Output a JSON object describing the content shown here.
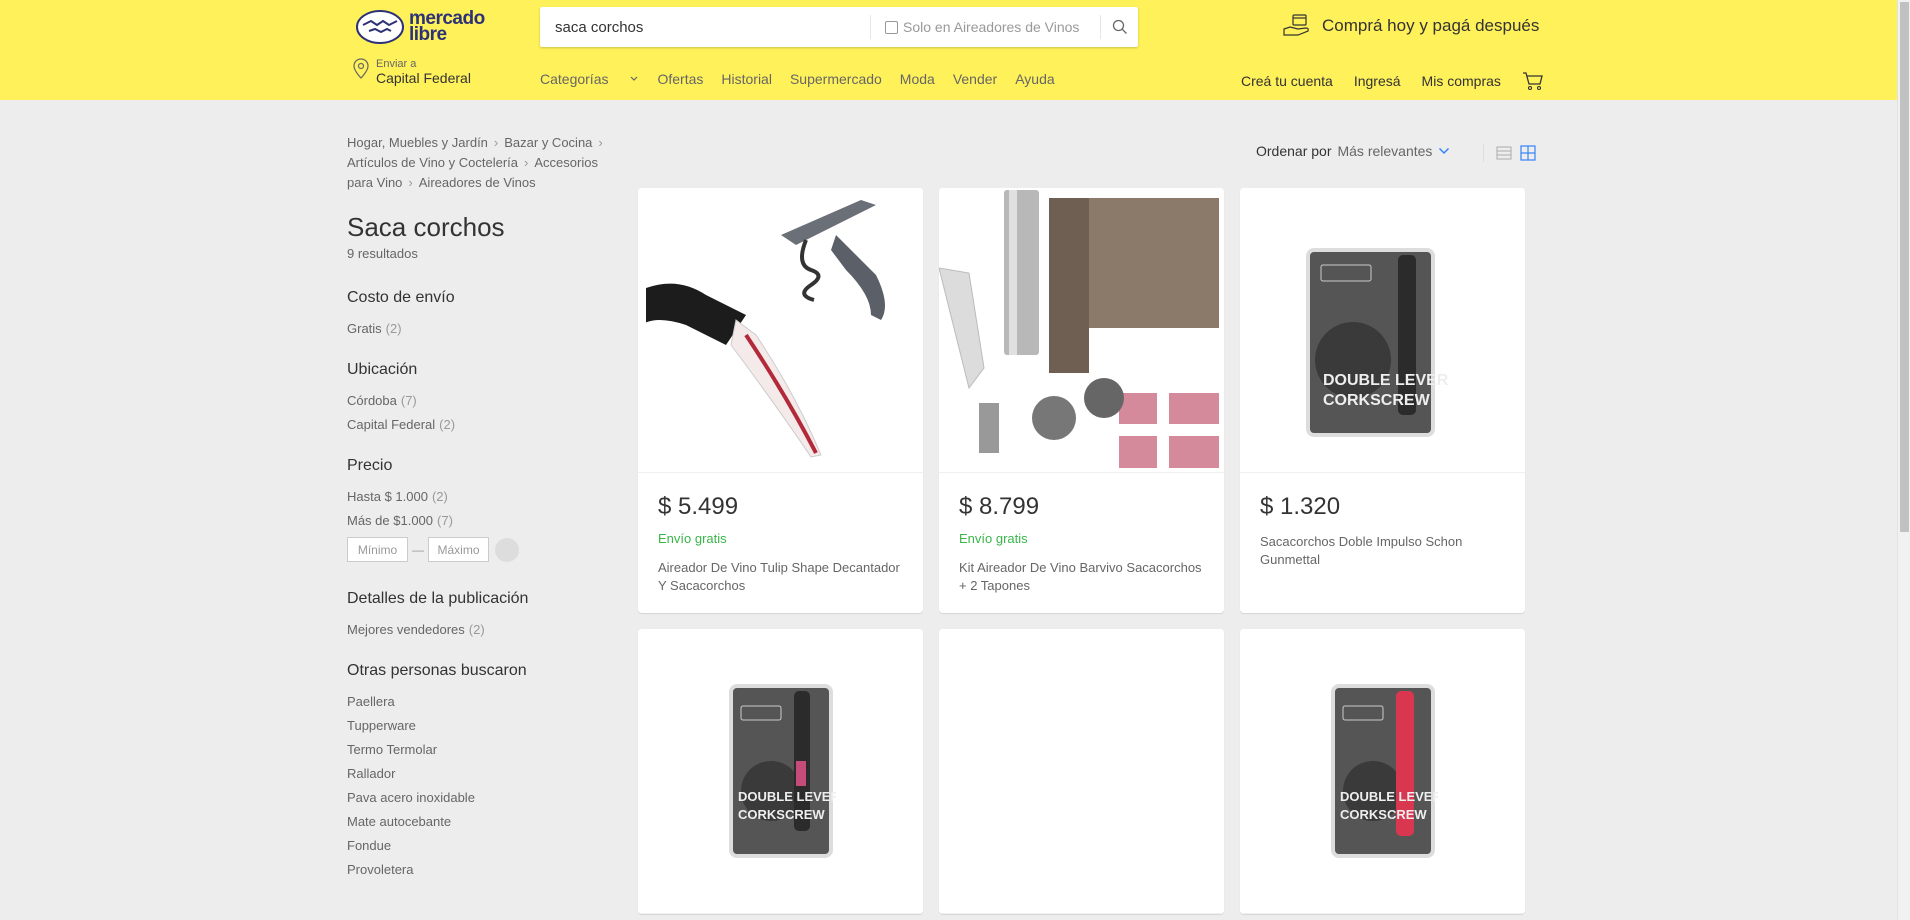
{
  "header": {
    "logo_line1": "mercado",
    "logo_line2": "libre",
    "search_value": "saca corchos",
    "search_filter_label": "Solo en Aireadores de Vinos",
    "promo_text": "Comprá hoy y pagá después",
    "location_label": "Enviar a",
    "location_city": "Capital Federal",
    "nav": [
      "Categorías",
      "Ofertas",
      "Historial",
      "Supermercado",
      "Moda",
      "Vender",
      "Ayuda"
    ],
    "user_nav": [
      "Creá tu cuenta",
      "Ingresá",
      "Mis compras"
    ]
  },
  "breadcrumb": [
    "Hogar, Muebles y Jardín",
    "Bazar y Cocina",
    "Artículos de Vino y Coctelería",
    "Accesorios para Vino",
    "Aireadores de Vinos"
  ],
  "page": {
    "title": "Saca corchos",
    "results": "9 resultados"
  },
  "filters": {
    "shipping": {
      "title": "Costo de envío",
      "items": [
        {
          "label": "Gratis",
          "count": "(2)"
        }
      ]
    },
    "location": {
      "title": "Ubicación",
      "items": [
        {
          "label": "Córdoba",
          "count": "(7)"
        },
        {
          "label": "Capital Federal",
          "count": "(2)"
        }
      ]
    },
    "price": {
      "title": "Precio",
      "items": [
        {
          "label": "Hasta $ 1.000",
          "count": "(2)"
        },
        {
          "label": "Más de $1.000",
          "count": "(7)"
        }
      ],
      "min_placeholder": "Mínimo",
      "max_placeholder": "Máximo"
    },
    "details": {
      "title": "Detalles de la publicación",
      "items": [
        {
          "label": "Mejores vendedores",
          "count": "(2)"
        }
      ]
    },
    "others": {
      "title": "Otras personas buscaron",
      "items": [
        "Paellera",
        "Tupperware",
        "Termo Termolar",
        "Rallador",
        "Pava acero inoxidable",
        "Mate autocebante",
        "Fondue",
        "Provoletera"
      ]
    }
  },
  "sort": {
    "label": "Ordenar por",
    "value": "Más relevantes"
  },
  "products": [
    {
      "price": "$ 5.499",
      "shipping": "Envío gratis",
      "title": "Aireador De Vino Tulip Shape Decantador Y Sacacorchos",
      "image": "aerator-corkscrew"
    },
    {
      "price": "$ 8.799",
      "shipping": "Envío gratis",
      "title": "Kit Aireador De Vino Barvivo Sacacorchos + 2 Tapones",
      "image": "aerator-kit-box"
    },
    {
      "price": "$ 1.320",
      "shipping": "",
      "title": "Sacacorchos Doble Impulso Schon Gunmettal",
      "image": "corkscrew-pack-gray"
    },
    {
      "price": "",
      "shipping": "",
      "title": "",
      "image": "corkscrew-pack-pink"
    },
    {
      "price": "",
      "shipping": "",
      "title": "",
      "image": "blank"
    },
    {
      "price": "",
      "shipping": "",
      "title": "",
      "image": "corkscrew-pack-red"
    }
  ],
  "colors": {
    "header": "#fff159",
    "shipping": "#39b54a",
    "accent": "#3483fa"
  }
}
